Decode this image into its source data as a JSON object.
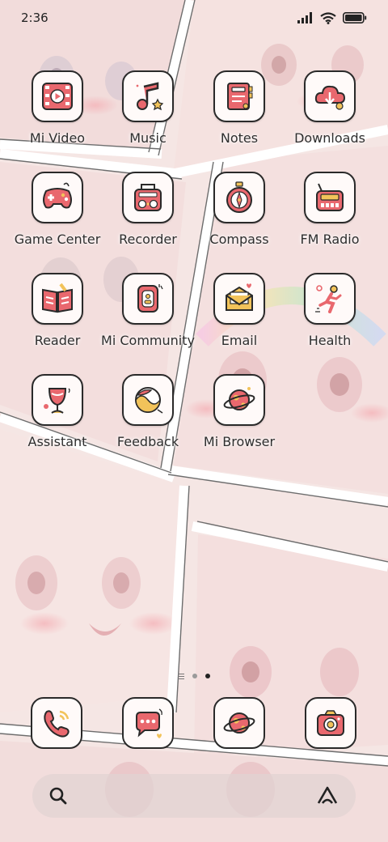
{
  "status": {
    "time": "2:36"
  },
  "apps": [
    {
      "label": "Mi Video",
      "icon": "video-icon"
    },
    {
      "label": "Music",
      "icon": "music-note-icon"
    },
    {
      "label": "Notes",
      "icon": "notebook-icon"
    },
    {
      "label": "Downloads",
      "icon": "cloud-download-icon"
    },
    {
      "label": "Game Center",
      "icon": "gamepad-icon"
    },
    {
      "label": "Recorder",
      "icon": "radio-recorder-icon"
    },
    {
      "label": "Compass",
      "icon": "compass-icon"
    },
    {
      "label": "FM Radio",
      "icon": "fm-radio-icon"
    },
    {
      "label": "Reader",
      "icon": "open-book-icon"
    },
    {
      "label": "Mi Community",
      "icon": "community-icon"
    },
    {
      "label": "Email",
      "icon": "envelope-icon"
    },
    {
      "label": "Health",
      "icon": "runner-icon"
    },
    {
      "label": "Assistant",
      "icon": "assistant-cup-icon"
    },
    {
      "label": "Feedback",
      "icon": "feedback-icon"
    },
    {
      "label": "Mi Browser",
      "icon": "planet-icon"
    }
  ],
  "dock": [
    {
      "icon": "phone-icon"
    },
    {
      "icon": "chat-bubble-icon"
    },
    {
      "icon": "planet-icon"
    },
    {
      "icon": "camera-icon"
    }
  ],
  "colors": {
    "accent": "#e9686e",
    "outline": "#2a2a2a",
    "gold": "#f2c35a",
    "background": "#f3e3e2"
  }
}
